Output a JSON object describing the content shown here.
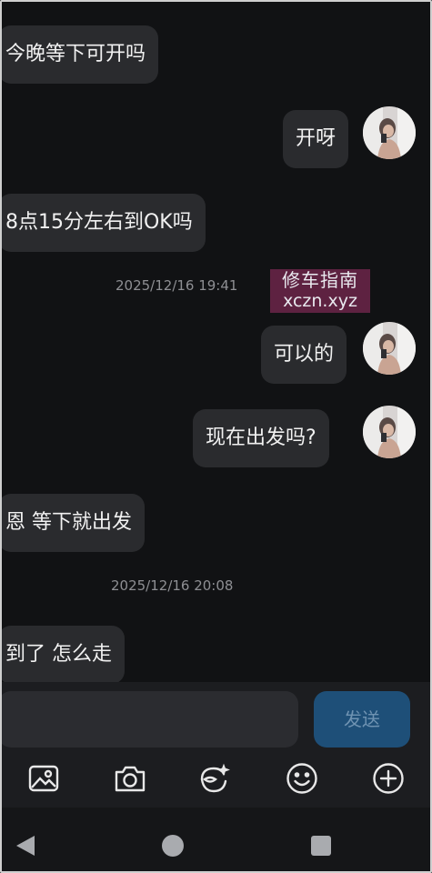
{
  "messages": [
    {
      "side": "left",
      "text": "今晚等下可开吗"
    },
    {
      "side": "right",
      "text": "开呀"
    },
    {
      "side": "left",
      "text": "8点15分左右到OK吗"
    },
    {
      "side": "right",
      "text": "可以的"
    },
    {
      "side": "right",
      "text": "现在出发吗?"
    },
    {
      "side": "left",
      "text": "恩 等下就出发"
    },
    {
      "side": "left",
      "text": "到了 怎么走"
    }
  ],
  "timestamps": [
    "2025/12/16 19:41",
    "2025/12/16 20:08"
  ],
  "watermark": {
    "line1": "修车指南",
    "line2": "xczn.xyz"
  },
  "composer": {
    "placeholder": "",
    "send_label": "发送"
  },
  "toolbar_icons": [
    "image-icon",
    "camera-icon",
    "sticker-icon",
    "emoji-icon",
    "plus-icon"
  ],
  "nav_icons": [
    "back-icon",
    "home-icon",
    "recents-icon"
  ],
  "colors": {
    "background": "#111214",
    "bubble": "#2a2b2e",
    "send_button": "#1e4f78",
    "timestamp": "#8e8f93"
  }
}
